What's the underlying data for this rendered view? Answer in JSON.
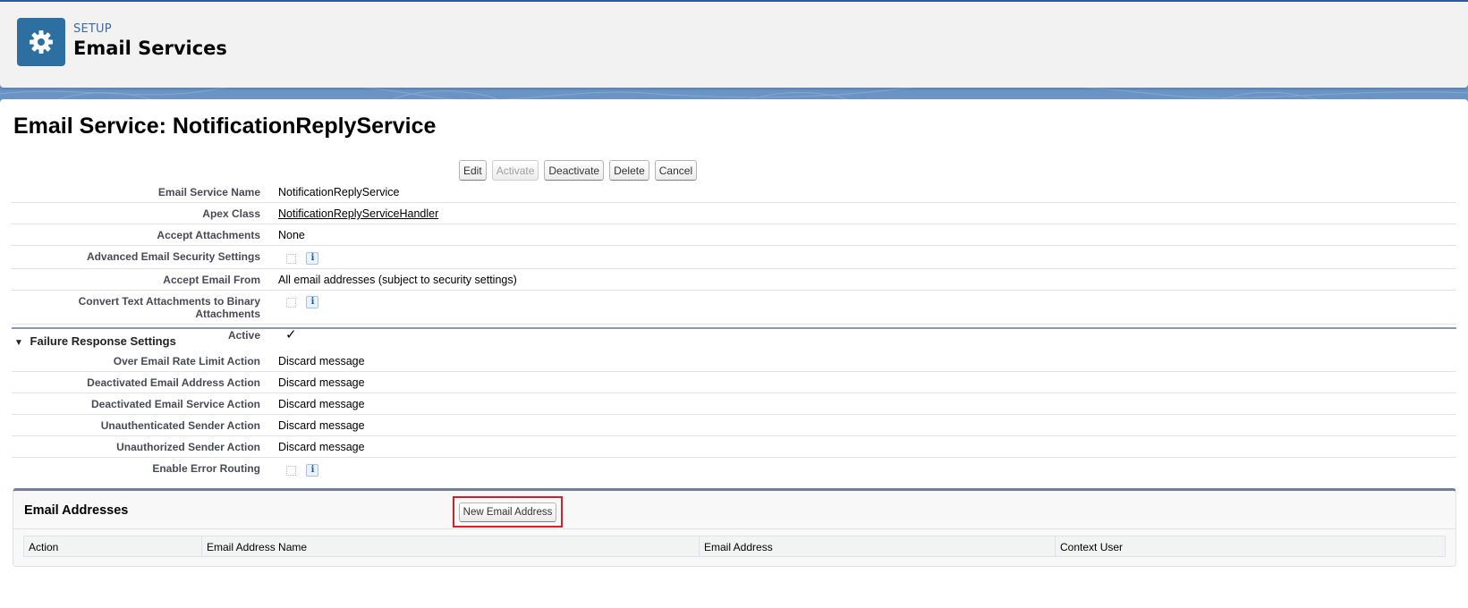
{
  "header": {
    "eyebrow": "SETUP",
    "title": "Email Services",
    "icon": "gear-icon"
  },
  "page": {
    "title": "Email Service: NotificationReplyService"
  },
  "toolbar": {
    "edit": "Edit",
    "activate": "Activate",
    "deactivate": "Deactivate",
    "delete": "Delete",
    "cancel": "Cancel"
  },
  "details": [
    {
      "label": "Email Service Name",
      "value": "NotificationReplyService"
    },
    {
      "label": "Apex Class",
      "value": "NotificationReplyServiceHandler",
      "link": true
    },
    {
      "label": "Accept Attachments",
      "value": "None"
    },
    {
      "label": "Advanced Email Security Settings",
      "checked": false,
      "info": "i"
    },
    {
      "label": "Accept Email From",
      "value": "All email addresses (subject to security settings)"
    },
    {
      "label": "Convert Text Attachments to Binary Attachments",
      "checked": false,
      "info": "i"
    },
    {
      "label": "Active",
      "checked": true,
      "check_glyph": "✓"
    }
  ],
  "failure_section": {
    "title": "Failure Response Settings",
    "toggle_glyph": "▼",
    "rows": [
      {
        "label": "Over Email Rate Limit Action",
        "value": "Discard message"
      },
      {
        "label": "Deactivated Email Address Action",
        "value": "Discard message"
      },
      {
        "label": "Deactivated Email Service Action",
        "value": "Discard message"
      },
      {
        "label": "Unauthenticated Sender Action",
        "value": "Discard message"
      },
      {
        "label": "Unauthorized Sender Action",
        "value": "Discard message"
      },
      {
        "label": "Enable Error Routing",
        "checked": false,
        "info": "i"
      }
    ]
  },
  "email_addresses": {
    "title": "Email Addresses",
    "new_button": "New Email Address",
    "columns": [
      "Action",
      "Email Address Name",
      "Email Address",
      "Context User"
    ],
    "rows": []
  },
  "colors": {
    "brand_icon": "#2d6fa0",
    "highlight": "#d0202b",
    "section_rule": "#747e96"
  }
}
